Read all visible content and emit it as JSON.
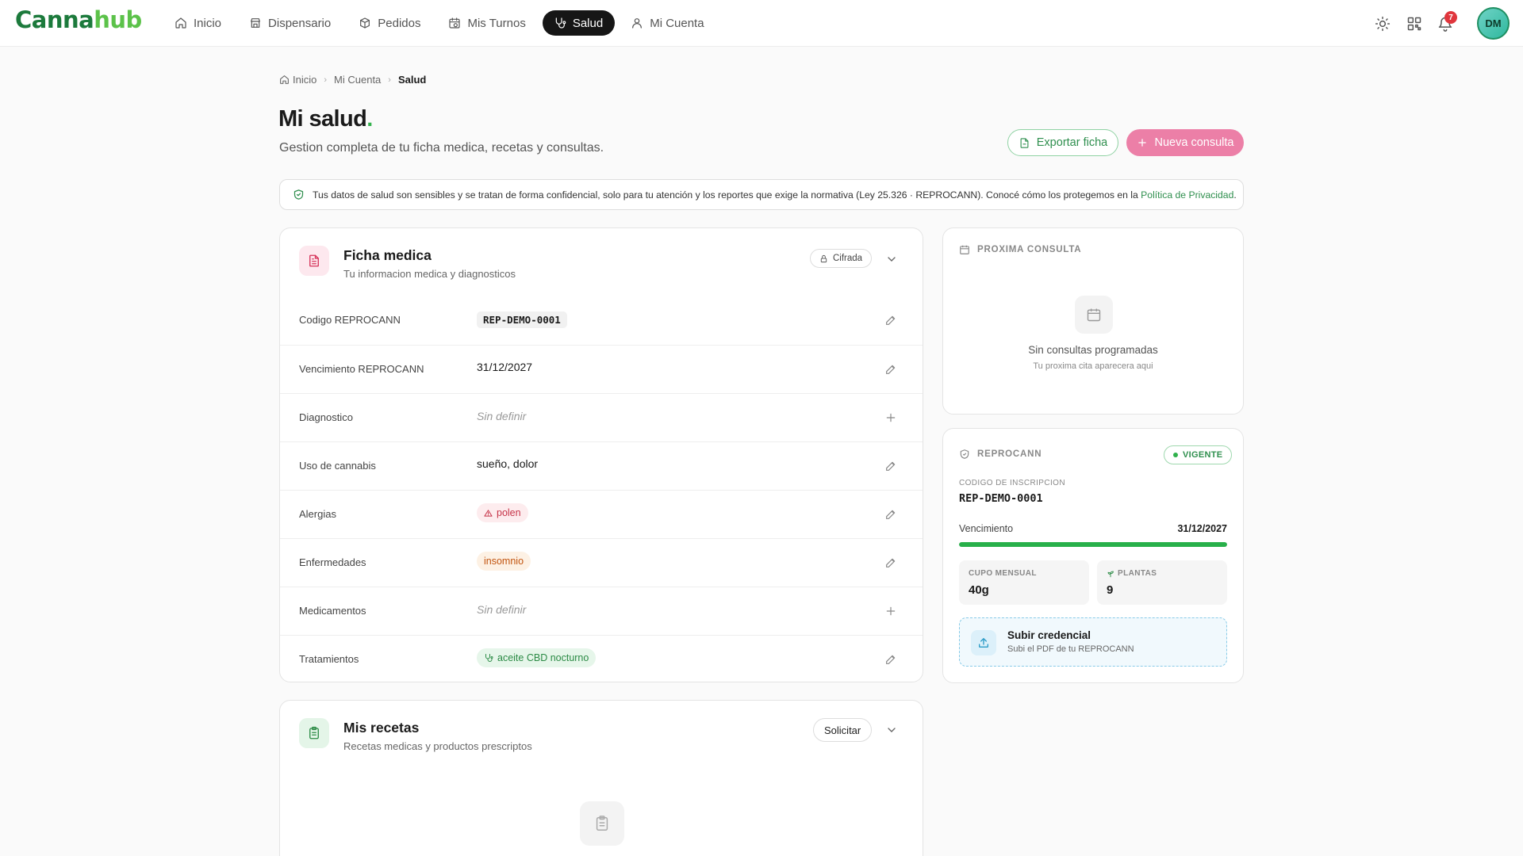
{
  "brand": {
    "part1": "Canna",
    "part2": "hub"
  },
  "nav": {
    "items": [
      {
        "label": "Inicio",
        "icon": "home-icon"
      },
      {
        "label": "Dispensario",
        "icon": "store-icon"
      },
      {
        "label": "Pedidos",
        "icon": "box-icon"
      },
      {
        "label": "Mis Turnos",
        "icon": "calendar-clock-icon"
      },
      {
        "label": "Salud",
        "icon": "stethoscope-icon",
        "active": true
      },
      {
        "label": "Mi Cuenta",
        "icon": "user-icon"
      }
    ]
  },
  "header": {
    "notifications_count": "7",
    "avatar_initials": "DM"
  },
  "breadcrumb": {
    "home": "Inicio",
    "parent": "Mi Cuenta",
    "current": "Salud"
  },
  "page": {
    "title": "Mi salud",
    "title_dot": ".",
    "subtitle": "Gestion completa de tu ficha medica, recetas y consultas.",
    "export_label": "Exportar ficha",
    "new_label": "Nueva consulta"
  },
  "notice": {
    "text": "Tus datos de salud son sensibles y se tratan de forma confidencial, solo para tu atención y los reportes que exige la normativa (Ley 25.326 · REPROCANN). Conocé cómo los protegemos en la ",
    "link": "Política de Privacidad",
    "end": "."
  },
  "ficha": {
    "title": "Ficha medica",
    "subtitle": "Tu informacion medica y diagnosticos",
    "badge": "Cifrada",
    "rows": [
      {
        "label": "Codigo REPROCANN",
        "value": "REP-DEMO-0001"
      },
      {
        "label": "Vencimiento REPROCANN",
        "value": "31/12/2027"
      },
      {
        "label": "Diagnostico",
        "value": "Sin definir"
      },
      {
        "label": "Uso de cannabis",
        "value": "sueño, dolor"
      },
      {
        "label": "Alergias",
        "value": "polen"
      },
      {
        "label": "Enfermedades",
        "value": "insomnio"
      },
      {
        "label": "Medicamentos",
        "value": "Sin definir"
      },
      {
        "label": "Tratamientos",
        "value": "aceite CBD nocturno"
      }
    ]
  },
  "recetas": {
    "title": "Mis recetas",
    "subtitle": "Recetas medicas y productos prescriptos",
    "button": "Solicitar"
  },
  "proxima": {
    "heading": "PROXIMA CONSULTA",
    "empty_title": "Sin consultas programadas",
    "empty_sub": "Tu proxima cita aparecera aqui"
  },
  "reprocann": {
    "heading": "REPROCANN",
    "status": "VIGENTE",
    "code_label": "CODIGO DE INSCRIPCION",
    "code": "REP-DEMO-0001",
    "expiry_label": "Vencimiento",
    "expiry": "31/12/2027",
    "validity_progress": 1.0,
    "quota_label": "CUPO MENSUAL",
    "quota": "40g",
    "plants_label": "PLANTAS",
    "plants": "9",
    "upload_title": "Subir credencial",
    "upload_sub": "Subi el PDF de tu REPROCANN"
  },
  "colors": {
    "brand_dark": "#1c7a3c",
    "brand_light": "#5cc24a",
    "accent_pink": "#ec7fa7",
    "success": "#28b04a"
  }
}
